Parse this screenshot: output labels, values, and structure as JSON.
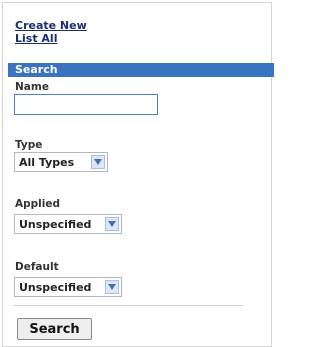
{
  "links": {
    "create_new": "Create New",
    "list_all": "List All"
  },
  "search": {
    "header": "Search",
    "name": {
      "label": "Name",
      "value": ""
    },
    "type": {
      "label": "Type",
      "selected": "All Types"
    },
    "applied": {
      "label": "Applied",
      "selected": "Unspecified"
    },
    "default": {
      "label": "Default",
      "selected": "Unspecified"
    },
    "submit_label": "Search"
  },
  "colors": {
    "header_bg": "#3a73c0",
    "link": "#1c2c73"
  }
}
